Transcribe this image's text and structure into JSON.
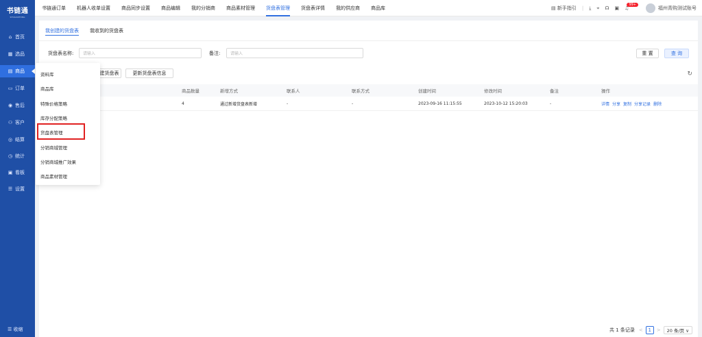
{
  "app": {
    "logo_title": "书链通",
    "logo_subtitle": "SHULIANTONG"
  },
  "sidebar": {
    "items": [
      {
        "label": "首页",
        "icon": "monitor-icon",
        "glyph": "⌂"
      },
      {
        "label": "选品",
        "icon": "grid-icon",
        "glyph": "▦"
      },
      {
        "label": "商品",
        "icon": "box-icon",
        "glyph": "▤"
      },
      {
        "label": "订单",
        "icon": "document-icon",
        "glyph": "▭"
      },
      {
        "label": "售后",
        "icon": "eye-icon",
        "glyph": "◉"
      },
      {
        "label": "客户",
        "icon": "users-icon",
        "glyph": "⚇"
      },
      {
        "label": "结算",
        "icon": "wallet-icon",
        "glyph": "◎"
      },
      {
        "label": "统计",
        "icon": "clock-icon",
        "glyph": "◷"
      },
      {
        "label": "看板",
        "icon": "screen-icon",
        "glyph": "▣"
      },
      {
        "label": "设置",
        "icon": "list-icon",
        "glyph": "☰"
      }
    ],
    "collapse_label": "☰ 收缩",
    "active_color": "#2f6fe0"
  },
  "topnav": {
    "items": [
      "书链通订单",
      "机器人收单设置",
      "商品同步设置",
      "商品编辑",
      "我的分销商",
      "商品素材管理",
      "货盘表管理",
      "货盘表详情",
      "我的供应商",
      "商品库"
    ],
    "active_index": 6,
    "guide_label": "新手指引",
    "badge": "99+",
    "account": "福州青购测试账号"
  },
  "subtabs": [
    "我创建的货盘表",
    "我收到的货盘表"
  ],
  "filters": {
    "name_label": "货盘表名称:",
    "name_placeholder": "请输入",
    "remark_label": "备注:",
    "remark_placeholder": "请输入",
    "reset_label": "重 置",
    "search_label": "查 询"
  },
  "actions": {
    "create_label": "建货盘表",
    "update_label": "更新货盘表信息"
  },
  "table": {
    "columns": [
      "商品数量",
      "新增方式",
      "联系人",
      "联系方式",
      "创建时间",
      "修改时间",
      "备注",
      "操作"
    ],
    "rows": [
      {
        "count": "4",
        "method": "通过新增货盘表新增",
        "contact": "-",
        "phone": "-",
        "created": "2023-09-16 11:15:55",
        "modified": "2023-10-12 15:20:03",
        "remark": "-",
        "ops": [
          "详情",
          "分享",
          "复制",
          "分享记录",
          "删除"
        ]
      }
    ]
  },
  "dropdown": {
    "items": [
      "资料库",
      "商品库",
      "特殊价格策略",
      "库存分配策略",
      "货盘表管理",
      "分销商城管理",
      "分销商城推广效果",
      "商品素材管理"
    ],
    "highlighted_index": 4
  },
  "pagination": {
    "total": "共 1 条记录",
    "prev": "<",
    "page": "1",
    "next": ">",
    "size": "20 条/页 ∨"
  }
}
